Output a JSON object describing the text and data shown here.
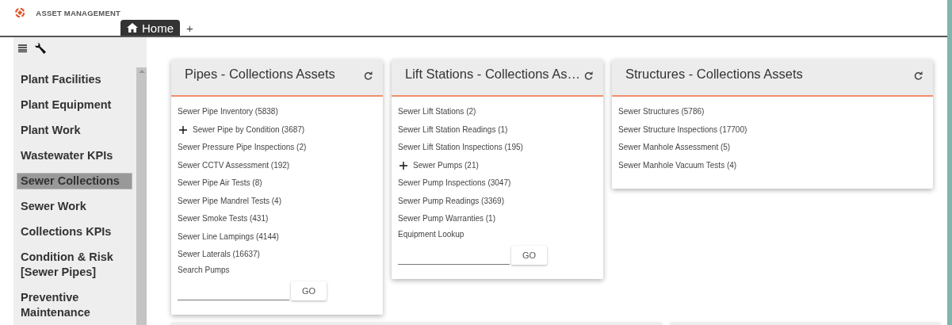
{
  "app": {
    "title": "ASSET MANAGEMENT"
  },
  "tabs": [
    {
      "label": "Home",
      "selected": true
    },
    {
      "label": "+",
      "selected": false
    }
  ],
  "sidebar": {
    "items": [
      {
        "label": "Plant Facilities",
        "selected": false
      },
      {
        "label": "Plant Equipment",
        "selected": false
      },
      {
        "label": "Plant Work",
        "selected": false
      },
      {
        "label": "Wastewater KPIs",
        "selected": false
      },
      {
        "label": "Sewer Collections",
        "selected": true
      },
      {
        "label": "Sewer Work",
        "selected": false
      },
      {
        "label": "Collections KPIs",
        "selected": false
      },
      {
        "label": "Condition & Risk [Sewer Pipes]",
        "selected": false
      },
      {
        "label": "Preventive Maintenance",
        "selected": false
      }
    ]
  },
  "cards": [
    {
      "title": "Pipes - Collections Assets",
      "items": [
        {
          "kind": "link",
          "label": "Sewer Pipe Inventory (5838)"
        },
        {
          "kind": "expandable",
          "label": "Sewer Pipe by Condition (3687)"
        },
        {
          "kind": "link",
          "label": "Sewer Pressure Pipe Inspections (2)"
        },
        {
          "kind": "link",
          "label": "Sewer CCTV Assessment (192)"
        },
        {
          "kind": "link",
          "label": "Sewer Pipe Air Tests (8)"
        },
        {
          "kind": "link",
          "label": "Sewer Pipe Mandrel Tests (4)"
        },
        {
          "kind": "link",
          "label": "Sewer Smoke Tests (431)"
        },
        {
          "kind": "link",
          "label": "Sewer Line Lampings (4144)"
        },
        {
          "kind": "link",
          "label": "Sewer Laterals (16637)"
        },
        {
          "kind": "search",
          "label": "Search Pumps",
          "button": "GO"
        }
      ]
    },
    {
      "title": "Lift Stations - Collections As…",
      "items": [
        {
          "kind": "link",
          "label": "Sewer Lift Stations (2)"
        },
        {
          "kind": "link",
          "label": "Sewer Lift Station Readings (1)"
        },
        {
          "kind": "link",
          "label": "Sewer Lift Station Inspections (195)"
        },
        {
          "kind": "expandable",
          "label": "Sewer Pumps (21)"
        },
        {
          "kind": "link",
          "label": "Sewer Pump Inspections (3047)"
        },
        {
          "kind": "link",
          "label": "Sewer Pump Readings (3369)"
        },
        {
          "kind": "link",
          "label": "Sewer Pump Warranties (1)"
        },
        {
          "kind": "search",
          "label": "Equipment Lookup",
          "button": "GO"
        }
      ]
    },
    {
      "title": "Structures - Collections Assets",
      "items": [
        {
          "kind": "link",
          "label": "Sewer Structures (5786)"
        },
        {
          "kind": "link",
          "label": "Sewer Structure Inspections (17700)"
        },
        {
          "kind": "link",
          "label": "Sewer Manhole Assessment (5)"
        },
        {
          "kind": "link",
          "label": "Sewer Manhole Vacuum Tests (4)"
        }
      ]
    }
  ]
}
